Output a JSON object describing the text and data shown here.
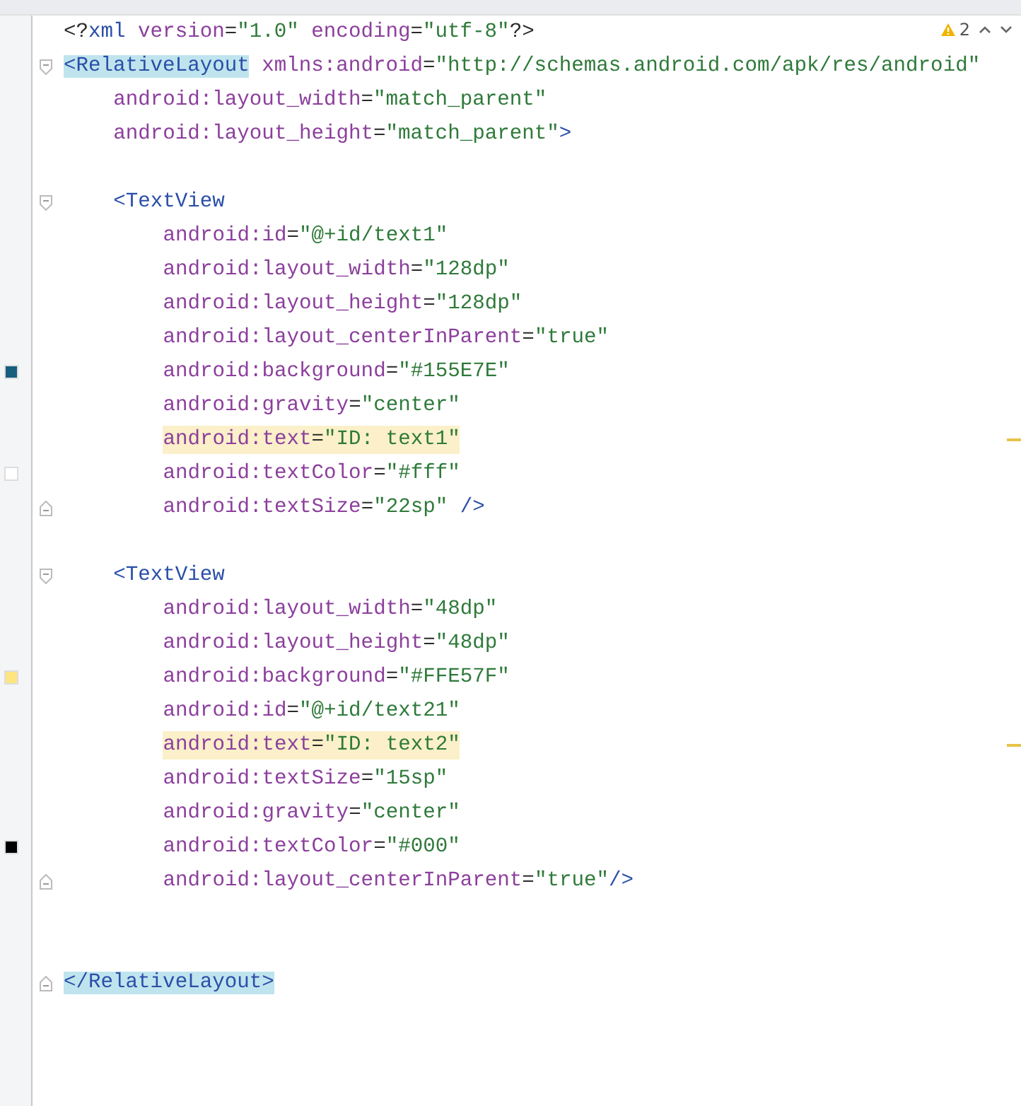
{
  "inspections": {
    "warning_count": "2"
  },
  "lines": [
    {
      "kind": "code",
      "tokens": [
        {
          "kind": "punct",
          "text": "<?"
        },
        {
          "kind": "tag",
          "text": "xml "
        },
        {
          "kind": "attr",
          "text": "version"
        },
        {
          "kind": "punct",
          "text": "="
        },
        {
          "kind": "value",
          "text": "\"1.0\" "
        },
        {
          "kind": "attr",
          "text": "encoding"
        },
        {
          "kind": "punct",
          "text": "="
        },
        {
          "kind": "value",
          "text": "\"utf-8\""
        },
        {
          "kind": "punct",
          "text": "?>"
        }
      ]
    },
    {
      "kind": "code",
      "fold_start": true,
      "tokens": [
        {
          "kind": "tag",
          "text": "<RelativeLayout",
          "matched": true
        },
        {
          "kind": "attr",
          "text": " xmlns:android"
        },
        {
          "kind": "punct",
          "text": "="
        },
        {
          "kind": "value",
          "text": "\"http://schemas.android.com/apk/res/android\""
        }
      ],
      "children": [
        {
          "kind": "code",
          "tokens": [
            {
              "kind": "attr",
              "text": "android:layout_width"
            },
            {
              "kind": "punct",
              "text": "="
            },
            {
              "kind": "value",
              "text": "\"match_parent\""
            }
          ]
        },
        {
          "kind": "code",
          "tokens": [
            {
              "kind": "attr",
              "text": "android:layout_height"
            },
            {
              "kind": "punct",
              "text": "="
            },
            {
              "kind": "value",
              "text": "\"match_parent\""
            },
            {
              "kind": "tag",
              "text": ">"
            }
          ]
        },
        {
          "kind": "blank"
        },
        {
          "kind": "code",
          "fold_start": true,
          "tokens": [
            {
              "kind": "tag",
              "text": "<TextView"
            }
          ],
          "children": [
            {
              "kind": "code",
              "tokens": [
                {
                  "kind": "attr",
                  "text": "android:id"
                },
                {
                  "kind": "punct",
                  "text": "="
                },
                {
                  "kind": "value",
                  "text": "\"@+id/text1\""
                }
              ]
            },
            {
              "kind": "code",
              "tokens": [
                {
                  "kind": "attr",
                  "text": "android:layout_width"
                },
                {
                  "kind": "punct",
                  "text": "="
                },
                {
                  "kind": "value",
                  "text": "\"128dp\""
                }
              ]
            },
            {
              "kind": "code",
              "tokens": [
                {
                  "kind": "attr",
                  "text": "android:layout_height"
                },
                {
                  "kind": "punct",
                  "text": "="
                },
                {
                  "kind": "value",
                  "text": "\"128dp\""
                }
              ]
            },
            {
              "kind": "code",
              "tokens": [
                {
                  "kind": "attr",
                  "text": "android:layout_centerInParent"
                },
                {
                  "kind": "punct",
                  "text": "="
                },
                {
                  "kind": "value",
                  "text": "\"true\""
                }
              ]
            },
            {
              "kind": "code",
              "color": "#155e7e",
              "tokens": [
                {
                  "kind": "attr",
                  "text": "android:background"
                },
                {
                  "kind": "punct",
                  "text": "="
                },
                {
                  "kind": "value",
                  "text": "\"#155E7E\""
                }
              ]
            },
            {
              "kind": "code",
              "tokens": [
                {
                  "kind": "attr",
                  "text": "android:gravity"
                },
                {
                  "kind": "punct",
                  "text": "="
                },
                {
                  "kind": "value",
                  "text": "\"center\""
                }
              ]
            },
            {
              "kind": "code",
              "highlighted": true,
              "tokens": [
                {
                  "kind": "attr",
                  "text": "android:text"
                },
                {
                  "kind": "punct",
                  "text": "="
                },
                {
                  "kind": "value",
                  "text": "\"ID: text1\""
                }
              ]
            },
            {
              "kind": "code",
              "color": "#ffffff",
              "tokens": [
                {
                  "kind": "attr",
                  "text": "android:textColor"
                },
                {
                  "kind": "punct",
                  "text": "="
                },
                {
                  "kind": "value",
                  "text": "\"#fff\""
                }
              ]
            },
            {
              "kind": "code",
              "fold_end": true,
              "tokens": [
                {
                  "kind": "attr",
                  "text": "android:textSize"
                },
                {
                  "kind": "punct",
                  "text": "="
                },
                {
                  "kind": "value",
                  "text": "\"22sp\""
                },
                {
                  "kind": "tag",
                  "text": " />"
                }
              ]
            }
          ]
        },
        {
          "kind": "blank"
        },
        {
          "kind": "code",
          "fold_start": true,
          "tokens": [
            {
              "kind": "tag",
              "text": "<TextView"
            }
          ],
          "children": [
            {
              "kind": "code",
              "tokens": [
                {
                  "kind": "attr",
                  "text": "android:layout_width"
                },
                {
                  "kind": "punct",
                  "text": "="
                },
                {
                  "kind": "value",
                  "text": "\"48dp\""
                }
              ]
            },
            {
              "kind": "code",
              "tokens": [
                {
                  "kind": "attr",
                  "text": "android:layout_height"
                },
                {
                  "kind": "punct",
                  "text": "="
                },
                {
                  "kind": "value",
                  "text": "\"48dp\""
                }
              ]
            },
            {
              "kind": "code",
              "color": "#ffe57f",
              "tokens": [
                {
                  "kind": "attr",
                  "text": "android:background"
                },
                {
                  "kind": "punct",
                  "text": "="
                },
                {
                  "kind": "value",
                  "text": "\"#FFE57F\""
                }
              ]
            },
            {
              "kind": "code",
              "tokens": [
                {
                  "kind": "attr",
                  "text": "android:id"
                },
                {
                  "kind": "punct",
                  "text": "="
                },
                {
                  "kind": "value",
                  "text": "\"@+id/text21\""
                }
              ]
            },
            {
              "kind": "code",
              "highlighted": true,
              "tokens": [
                {
                  "kind": "attr",
                  "text": "android:text"
                },
                {
                  "kind": "punct",
                  "text": "="
                },
                {
                  "kind": "value",
                  "text": "\"ID: text2\""
                }
              ]
            },
            {
              "kind": "code",
              "tokens": [
                {
                  "kind": "attr",
                  "text": "android:textSize"
                },
                {
                  "kind": "punct",
                  "text": "="
                },
                {
                  "kind": "value",
                  "text": "\"15sp\""
                }
              ]
            },
            {
              "kind": "code",
              "tokens": [
                {
                  "kind": "attr",
                  "text": "android:gravity"
                },
                {
                  "kind": "punct",
                  "text": "="
                },
                {
                  "kind": "value",
                  "text": "\"center\""
                }
              ]
            },
            {
              "kind": "code",
              "color": "#000000",
              "tokens": [
                {
                  "kind": "attr",
                  "text": "android:textColor"
                },
                {
                  "kind": "punct",
                  "text": "="
                },
                {
                  "kind": "value",
                  "text": "\"#000\""
                }
              ]
            },
            {
              "kind": "code",
              "fold_end": true,
              "tokens": [
                {
                  "kind": "attr",
                  "text": "android:layout_centerInParent"
                },
                {
                  "kind": "punct",
                  "text": "="
                },
                {
                  "kind": "value",
                  "text": "\"true\""
                },
                {
                  "kind": "tag",
                  "text": "/>"
                }
              ]
            }
          ]
        },
        {
          "kind": "blank"
        },
        {
          "kind": "blank"
        }
      ]
    },
    {
      "kind": "code",
      "fold_end": true,
      "tokens": [
        {
          "kind": "tag",
          "text": "</RelativeLayout>",
          "matched": true
        }
      ]
    }
  ]
}
